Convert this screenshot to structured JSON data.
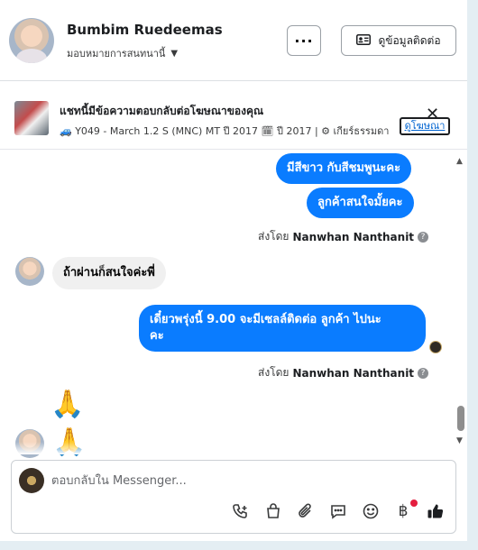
{
  "header": {
    "contact_name": "Bumbim Ruedeemas",
    "assign_label": "มอบหมายการสนทนานี้",
    "more_label": "···",
    "contact_info_label": "ดูข้อมูลติดต่อ"
  },
  "ad": {
    "title": "แชทนี้มีข้อความตอบกลับต่อโฆษณาของคุณ",
    "detail": "🚙 Y049 - March 1.2 S (MNC) MT ปี 2017 🗓 ปี 2017 | ⚙ เกียร์ธรรมดา",
    "view_ad_label": "ดูโฆษณา",
    "close_label": "✕"
  },
  "messages": {
    "out1": "มีสีขาว กับสีชมพูนะคะ",
    "out2": "ลูกค้าสนใจมั้ยคะ",
    "sent_by_label": "ส่งโดย",
    "sender": "Nanwhan Nanthanit",
    "in1": "ถ้าผ่านก็สนใจค่ะพี่",
    "out3_line1": "เดี๋ยวพรุ่งนี้  9.00 จะมีเซลล์ติดต่อ ลูกค้า ไปนะ",
    "out3_line2": "คะ",
    "sent_by_label2": "ส่งโดย",
    "sender2": "Nanwhan Nanthanit",
    "help": "?",
    "emoji1": "🙏",
    "emoji2": "🙏"
  },
  "composer": {
    "placeholder": "ตอบกลับใน Messenger..."
  },
  "tools": [
    "call-icon",
    "bag-icon",
    "paperclip-icon",
    "saved-reply-icon",
    "emoji-icon",
    "baht-icon",
    "like-icon"
  ],
  "colors": {
    "outgoing_bubble": "#0a7cff",
    "incoming_bubble": "#f0f0f0",
    "notification_dot": "#e41e3f"
  }
}
